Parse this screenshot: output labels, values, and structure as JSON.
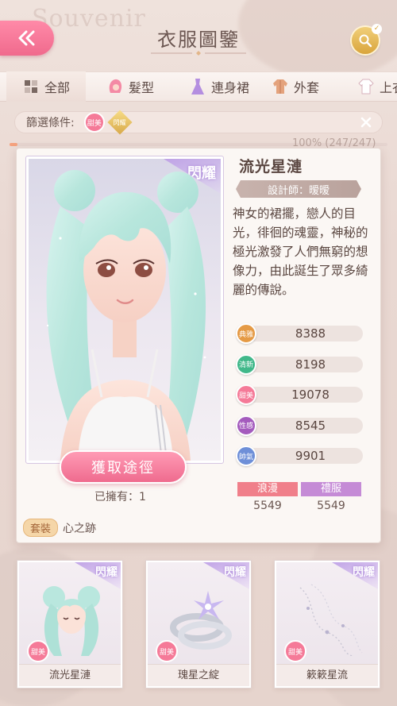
{
  "header": {
    "title": "衣服圖鑒",
    "bg_word": "Souvenir"
  },
  "tabs": [
    {
      "label": "全部",
      "icon": "grid-icon",
      "active": true
    },
    {
      "label": "髮型",
      "icon": "hair-icon",
      "active": false
    },
    {
      "label": "連身裙",
      "icon": "dress-icon",
      "active": false
    },
    {
      "label": "外套",
      "icon": "coat-icon",
      "active": false
    },
    {
      "label": "上衣",
      "icon": "shirt-icon",
      "active": false
    }
  ],
  "filter": {
    "label": "篩選條件:",
    "chip_attr": "甜美",
    "chip_rarity": "閃耀"
  },
  "collection": {
    "text": "100% (247/247)",
    "progress": 1.0
  },
  "item": {
    "badge": "閃耀",
    "name": "流光星漣",
    "designer": "設計師：暧暧",
    "description": "神女的裙擺，戀人的目光，徘徊的魂靈，神秘的極光激發了人們無窮的想像力，由此誕生了眾多綺麗的傳說。",
    "get_button": "獲取途徑",
    "owned": "已擁有：1",
    "set_label": "套裝",
    "set_name": "心之跡",
    "stats": [
      {
        "label": "典雅",
        "value": "8388",
        "color": "#e59a45"
      },
      {
        "label": "清新",
        "value": "8198",
        "color": "#41b88a"
      },
      {
        "label": "甜美",
        "value": "19078",
        "color": "#f57a98"
      },
      {
        "label": "性感",
        "value": "8545",
        "color": "#a45bbd"
      },
      {
        "label": "帥氣",
        "value": "9901",
        "color": "#6e8fd8"
      }
    ],
    "tags": [
      {
        "label": "浪漫",
        "value": "5549",
        "color": "#f07f8a"
      },
      {
        "label": "禮服",
        "value": "5549",
        "color": "#c58bd6"
      }
    ]
  },
  "items": [
    {
      "name": "流光星漣",
      "attr": "甜美",
      "badge": "閃耀"
    },
    {
      "name": "瑰星之綻",
      "attr": "甜美",
      "badge": "閃耀"
    },
    {
      "name": "簌簌星流",
      "attr": "甜美",
      "badge": "閃耀"
    }
  ]
}
